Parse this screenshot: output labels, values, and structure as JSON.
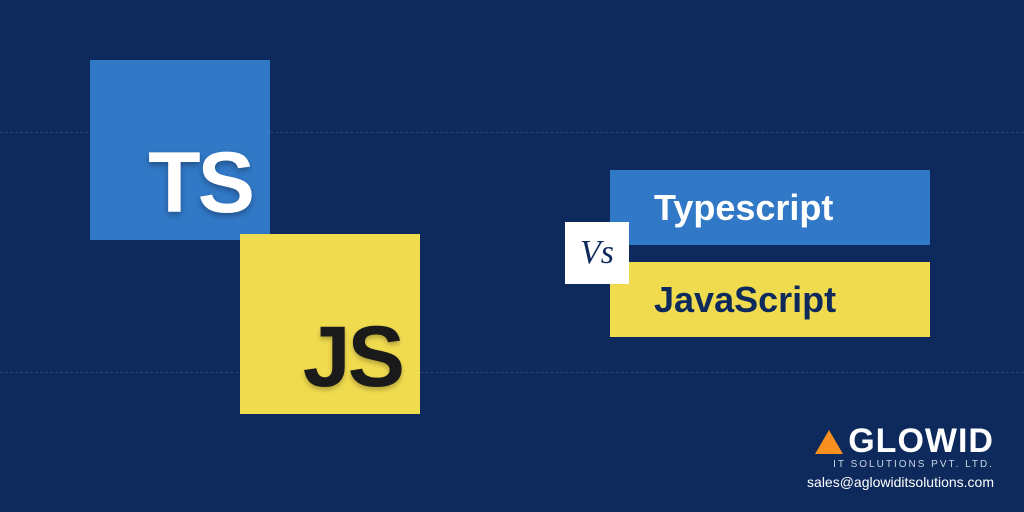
{
  "tiles": {
    "ts": "TS",
    "js": "JS"
  },
  "labels": {
    "typescript": "Typescript",
    "javascript": "JavaScript",
    "vs": "Vs"
  },
  "brand": {
    "name": "GLOWID",
    "subtitle": "IT SOLUTIONS PVT. LTD.",
    "email": "sales@aglowiditsolutions.com"
  },
  "colors": {
    "bg": "#0e2a5c",
    "ts": "#3178c6",
    "js": "#f0db4f",
    "accent": "#f7901e"
  }
}
